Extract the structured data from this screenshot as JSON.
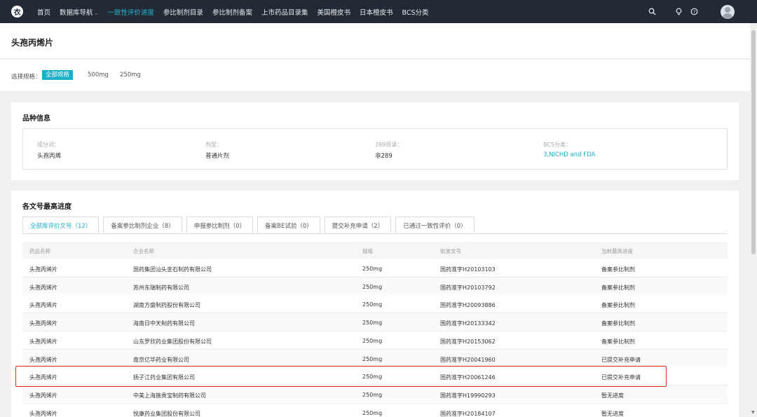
{
  "nav": {
    "logo": "衣",
    "items": [
      {
        "label": "首页",
        "active": false
      },
      {
        "label": "数据库导航",
        "active": false,
        "dropdown": true
      },
      {
        "label": "一致性评价进度",
        "active": true
      },
      {
        "label": "参比制剂目录",
        "active": false
      },
      {
        "label": "参比制剂备案",
        "active": false
      },
      {
        "label": "上市药品目录集",
        "active": false
      },
      {
        "label": "美国橙皮书",
        "active": false
      },
      {
        "label": "日本橙皮书",
        "active": false
      },
      {
        "label": "BCS分类",
        "active": false
      }
    ],
    "icons": [
      "search-icon",
      "lightbulb-icon",
      "help-icon",
      "avatar"
    ]
  },
  "page": {
    "title": "头孢丙烯片"
  },
  "spec": {
    "label": "选择规格：",
    "options": [
      "全部规格",
      "500mg",
      "250mg"
    ],
    "selected": "全部规格"
  },
  "variety": {
    "title": "品种信息",
    "fields": [
      {
        "label": "成分词：",
        "value": "头孢丙烯"
      },
      {
        "label": "剂型：",
        "value": "普通片剂"
      },
      {
        "label": "289目录：",
        "value": "非289"
      },
      {
        "label": "BCS分类：",
        "value": "3,NICHD and FDA"
      }
    ]
  },
  "progress": {
    "title": "各文号最高进度",
    "tabs": [
      "全部库评价文号（12）",
      "备案参比制剂企业（8）",
      "申报参比制剂（0）",
      "备案BE试验（0）",
      "提交补充申请（2）",
      "已通过一致性评价（0）"
    ],
    "active_tab": 0,
    "columns": [
      "药品名称",
      "企业名称",
      "规格",
      "批准文号",
      "当前最高进度"
    ],
    "rows": [
      [
        "头孢丙烯片",
        "国药集团汕头金石制药有限公司",
        "250mg",
        "国药准字H20103103",
        "备案参比制剂"
      ],
      [
        "头孢丙烯片",
        "苏州东瑞制药有限公司",
        "250mg",
        "国药准字H20103792",
        "备案参比制剂"
      ],
      [
        "头孢丙烯片",
        "湖南方盛制药股份有限公司",
        "250mg",
        "国药准字H20093886",
        "备案参比制剂"
      ],
      [
        "头孢丙烯片",
        "海南日中天制药有限公司",
        "250mg",
        "国药准字H20133342",
        "备案参比制剂"
      ],
      [
        "头孢丙烯片",
        "山东罗欣药业集团股份有限公司",
        "250mg",
        "国药准字H20153062",
        "备案参比制剂"
      ],
      [
        "头孢丙烯片",
        "南京亿华药业有限公司",
        "250mg",
        "国药准字H20041960",
        "已提交补充申请"
      ],
      [
        "头孢丙烯片",
        "扬子江药业集团有限公司",
        "250mg",
        "国药准字H20061246",
        "已提交补充申请"
      ],
      [
        "头孢丙烯片",
        "中美上海施贵宝制药有限公司",
        "250mg",
        "国药准字H19990293",
        "暂无进度"
      ],
      [
        "头孢丙烯片",
        "悦康药业集团股份有限公司",
        "250mg",
        "国药准字H20184107",
        "暂无进度"
      ]
    ],
    "highlighted_row": 6
  },
  "colors": {
    "nav_bg": "#222a36",
    "accent": "#1ab0c8",
    "highlight": "#e8271b"
  }
}
